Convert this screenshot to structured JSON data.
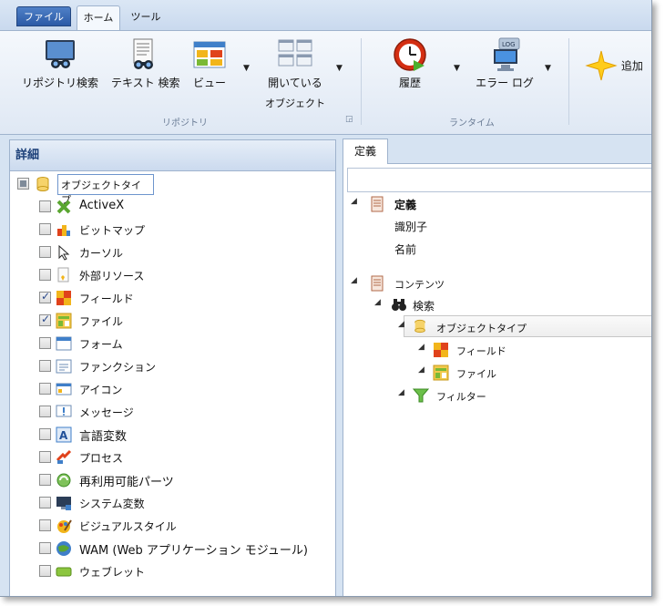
{
  "ribbon": {
    "tabs": [
      "ファイル",
      "ホーム",
      "ツール"
    ],
    "buttons": {
      "repo_search": "リポジトリ検索",
      "text_search": "テキスト 検索",
      "view": "ビュー",
      "open_objects_1": "開いている",
      "open_objects_2": "オブジェクト",
      "history": "履歴",
      "error_log": "エラー ログ",
      "add": "追加"
    },
    "groups": {
      "repository": "リポジトリ",
      "runtime": "ランタイム"
    }
  },
  "left_panel": {
    "title": "詳細",
    "root": "オブジェクトタイプ",
    "items": [
      {
        "label": "ActiveX",
        "checked": false,
        "icon": "activex-icon"
      },
      {
        "label": "ビットマップ",
        "checked": false,
        "icon": "bitmap-icon"
      },
      {
        "label": "カーソル",
        "checked": false,
        "icon": "cursor-icon"
      },
      {
        "label": "外部リソース",
        "checked": false,
        "icon": "external-resource-icon"
      },
      {
        "label": "フィールド",
        "checked": true,
        "icon": "field-icon"
      },
      {
        "label": "ファイル",
        "checked": true,
        "icon": "file-icon"
      },
      {
        "label": "フォーム",
        "checked": false,
        "icon": "form-icon"
      },
      {
        "label": "ファンクション",
        "checked": false,
        "icon": "function-icon"
      },
      {
        "label": "アイコン",
        "checked": false,
        "icon": "icon-icon"
      },
      {
        "label": "メッセージ",
        "checked": false,
        "icon": "message-icon"
      },
      {
        "label": "言語変数",
        "checked": false,
        "icon": "language-variable-icon"
      },
      {
        "label": "プロセス",
        "checked": false,
        "icon": "process-icon"
      },
      {
        "label": "再利用可能パーツ",
        "checked": false,
        "icon": "reusable-part-icon"
      },
      {
        "label": "システム変数",
        "checked": false,
        "icon": "system-variable-icon"
      },
      {
        "label": "ビジュアルスタイル",
        "checked": false,
        "icon": "visual-style-icon"
      },
      {
        "label": "WAM (Web アプリケーション モジュール)",
        "checked": false,
        "icon": "wam-icon"
      },
      {
        "label": "ウェブレット",
        "checked": false,
        "icon": "weblet-icon"
      }
    ]
  },
  "right_panel": {
    "tab": "定義",
    "definition": "定義",
    "identifier": "識別子",
    "name": "名前",
    "contents": "コンテンツ",
    "search": "検索",
    "object_type": "オブジェクトタイプ",
    "field": "フィールド",
    "file": "ファイル",
    "filter": "フィルター"
  }
}
